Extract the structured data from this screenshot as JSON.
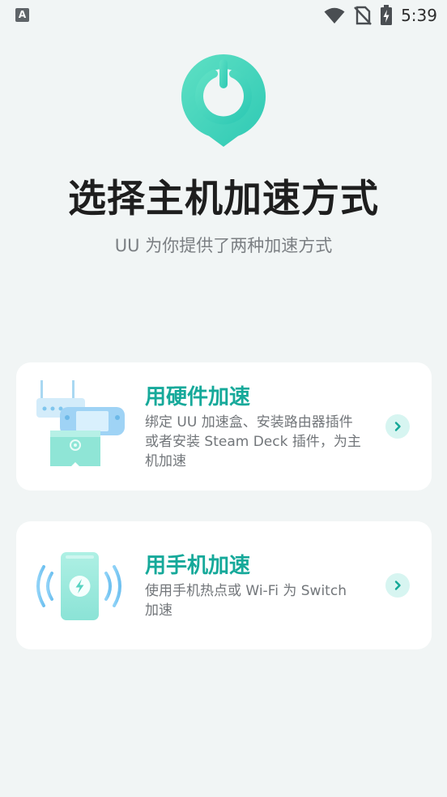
{
  "status_bar": {
    "app_badge": "A",
    "time": "5:39"
  },
  "header": {
    "title": "选择主机加速方式",
    "subtitle": "UU 为你提供了两种加速方式"
  },
  "options": {
    "hardware": {
      "title": "用硬件加速",
      "description": "绑定 UU 加速盒、安装路由器插件或者安装 Steam Deck 插件，为主机加速"
    },
    "phone": {
      "title": "用手机加速",
      "description": "使用手机热点或 Wi-Fi 为 Switch 加速"
    }
  },
  "colors": {
    "accent": "#16a99a",
    "background": "#f1f5f5",
    "card": "#ffffff"
  }
}
